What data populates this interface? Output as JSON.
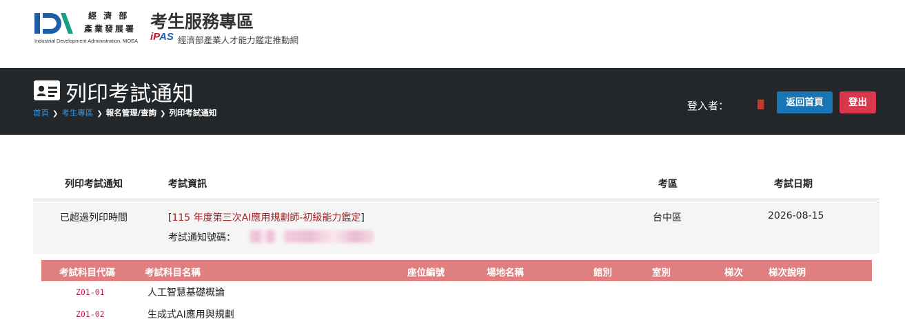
{
  "header": {
    "agency_name_line1": "經 濟 部",
    "agency_name_line2": "產業發展署",
    "agency_name_en": "Industrial Development Administration, MOEA",
    "service_title": "考生服務專區",
    "ipas_logo_ip": "iP",
    "ipas_logo_as": "AS",
    "ipas_subtitle": "經濟部產業人才能力鑑定推動網"
  },
  "banner": {
    "title": "列印考試通知",
    "breadcrumb": [
      "首頁",
      "考生專區",
      "報名管理/查詢",
      "列印考試通知"
    ],
    "login_label": "登入者：",
    "user_mark": "█",
    "home_button": "返回首頁",
    "logout_button": "登出"
  },
  "exam_table": {
    "headers": [
      "列印考試通知",
      "考試資訊",
      "考區",
      "考試日期"
    ],
    "row": {
      "print_status": "已超過列印時間",
      "exam_name_open": "[",
      "exam_name": "115 年度第三次AI應用規劃師-初級能力鑑定",
      "exam_name_close": "]",
      "notice_label": "考試通知號碼：",
      "region": "台中區",
      "date": "2026-08-15"
    }
  },
  "subject_table": {
    "headers": [
      "考試科目代碼",
      "考試科目名稱",
      "座位編號",
      "場地名稱",
      "館別",
      "室別",
      "梯次",
      "梯次說明"
    ],
    "rows": [
      {
        "code": "Z01-01",
        "name": "人工智慧基礎概論"
      },
      {
        "code": "Z01-02",
        "name": "生成式AI應用與規劃"
      }
    ]
  },
  "colors": {
    "banner_bg": "#24272a",
    "home_button": "#1a75b4",
    "logout_button": "#d9374b",
    "subject_header": "#e07f80",
    "exam_name_text": "#a32424",
    "code_text": "#c2185b"
  }
}
